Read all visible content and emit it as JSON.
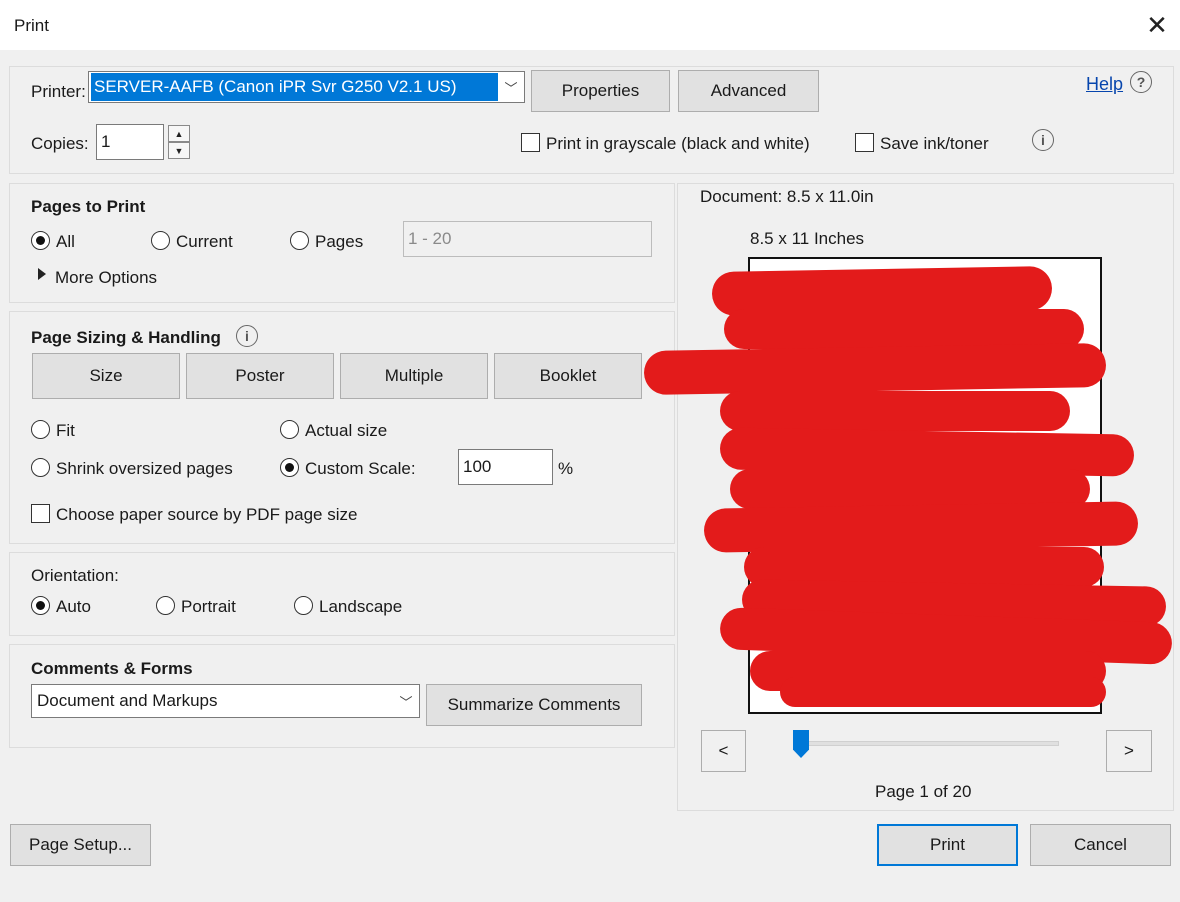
{
  "window": {
    "title": "Print",
    "close_glyph": "✕"
  },
  "printer": {
    "label": "Printer:",
    "selected": "SERVER-AAFB (Canon iPR Svr G250 V2.1 US)",
    "properties": "Properties",
    "advanced": "Advanced",
    "help": "Help",
    "copies_label": "Copies:",
    "copies_value": "1",
    "grayscale": "Print in grayscale (black and white)",
    "save_ink": "Save ink/toner"
  },
  "pages_to_print": {
    "heading": "Pages to Print",
    "all": "All",
    "current": "Current",
    "pages": "Pages",
    "range_placeholder": "1 - 20",
    "more_options": "More Options",
    "selected": "All"
  },
  "page_sizing": {
    "heading": "Page Sizing & Handling",
    "tabs": [
      "Size",
      "Poster",
      "Multiple",
      "Booklet"
    ],
    "fit": "Fit",
    "actual_size": "Actual size",
    "shrink": "Shrink oversized pages",
    "custom_scale": "Custom Scale:",
    "scale_value": "100",
    "percent": "%",
    "paper_source": "Choose paper source by PDF page size",
    "selected": "Custom Scale:"
  },
  "orientation": {
    "heading": "Orientation:",
    "auto": "Auto",
    "portrait": "Portrait",
    "landscape": "Landscape",
    "selected": "Auto"
  },
  "comments_forms": {
    "heading": "Comments & Forms",
    "selected": "Document and Markups",
    "summarize": "Summarize Comments"
  },
  "preview": {
    "document_size": "Document: 8.5 x 11.0in",
    "paper_size": "8.5 x 11 Inches",
    "prev": "<",
    "next": ">",
    "page_status": "Page 1 of 20",
    "page_current": 1,
    "page_total": 20
  },
  "footer": {
    "page_setup": "Page Setup...",
    "print": "Print",
    "cancel": "Cancel"
  },
  "colors": {
    "accent": "#0078d7",
    "redaction": "#e31b1b",
    "link": "#0645ad"
  }
}
